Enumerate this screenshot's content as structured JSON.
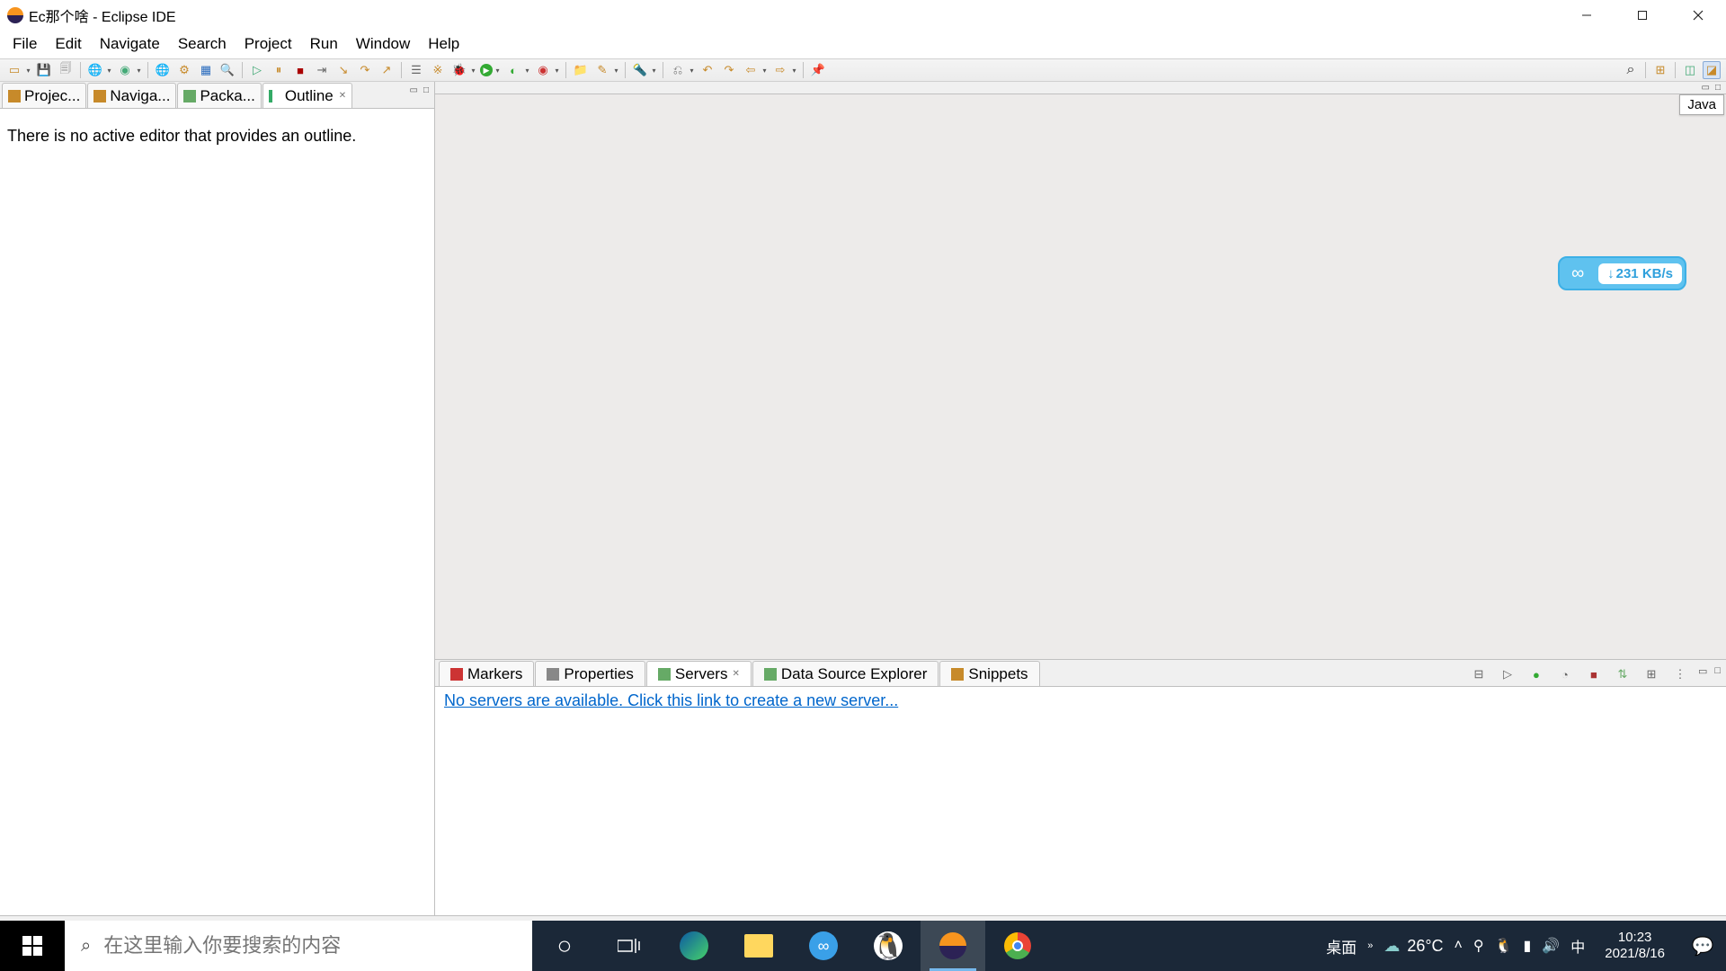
{
  "window": {
    "title": "Ec那个啥 - Eclipse IDE"
  },
  "menu": {
    "file": "File",
    "edit": "Edit",
    "navigate": "Navigate",
    "search": "Search",
    "project": "Project",
    "run": "Run",
    "window": "Window",
    "help": "Help"
  },
  "perspective": {
    "label": "Java"
  },
  "left_views": {
    "tabs": [
      {
        "label": "Projec...",
        "id": "project-explorer"
      },
      {
        "label": "Naviga...",
        "id": "navigator"
      },
      {
        "label": "Packa...",
        "id": "package-explorer"
      },
      {
        "label": "Outline",
        "id": "outline",
        "active": true,
        "closable": true
      }
    ],
    "outline_msg": "There is no active editor that provides an outline."
  },
  "bottom_panel": {
    "tabs": [
      {
        "label": "Markers"
      },
      {
        "label": "Properties"
      },
      {
        "label": "Servers",
        "active": true,
        "closable": true
      },
      {
        "label": "Data Source Explorer"
      },
      {
        "label": "Snippets"
      }
    ],
    "server_msg": "No servers are available. Click this link to create a new server..."
  },
  "float_download": {
    "speed": "231 KB/s"
  },
  "taskbar": {
    "search_placeholder": "在这里输入你要搜索的内容",
    "desktop": "桌面",
    "weather_temp": "26°C",
    "ime": "中",
    "time": "10:23",
    "date": "2021/8/16"
  }
}
